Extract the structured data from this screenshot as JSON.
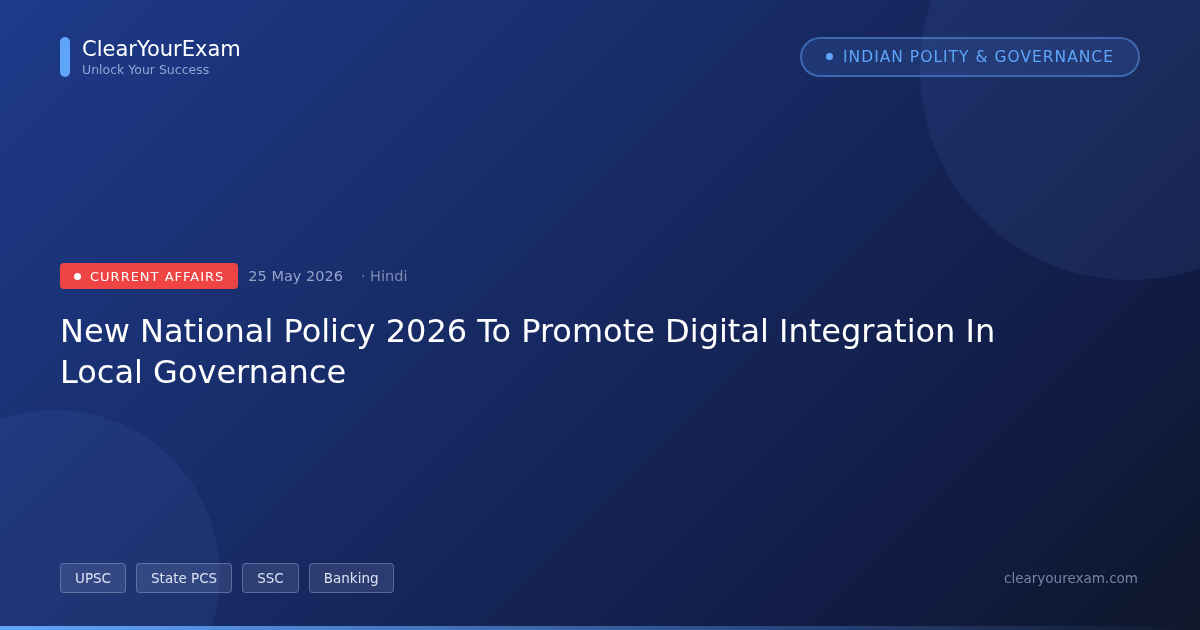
{
  "brand": {
    "name": "ClearYourExam",
    "tagline": "Unlock Your Success"
  },
  "category": {
    "label": "INDIAN POLITY & GOVERNANCE"
  },
  "article": {
    "badge": "CURRENT AFFAIRS",
    "date": "25 May 2026",
    "language": "· Hindi",
    "title": "New National Policy 2026 To Promote Digital Integration In Local Governance"
  },
  "tags": [
    "UPSC",
    "State PCS",
    "SSC",
    "Banking"
  ],
  "site": "clearyourexam.com"
}
